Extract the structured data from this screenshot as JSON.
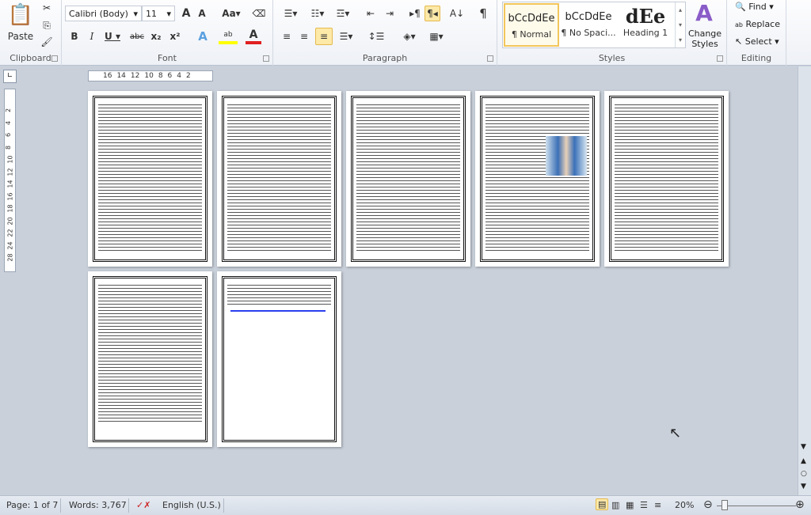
{
  "ribbon": {
    "clipboard": {
      "label": "Clipboard",
      "paste": "Paste"
    },
    "font": {
      "label": "Font",
      "name": "Calibri (Body)",
      "size": "11"
    },
    "paragraph": {
      "label": "Paragraph"
    },
    "styles": {
      "label": "Styles",
      "items": [
        {
          "preview": "bCcDdEe",
          "name": "¶ Normal"
        },
        {
          "preview": "bCcDdEe",
          "name": "¶ No Spaci..."
        },
        {
          "preview": "dEe",
          "name": "Heading 1"
        }
      ],
      "change": "Change Styles"
    },
    "editing": {
      "label": "Editing",
      "find": "Find",
      "replace": "Replace",
      "select": "Select"
    }
  },
  "ruler": {
    "ticks": [
      "16",
      "14",
      "12",
      "10",
      "8",
      "6",
      "4",
      "2"
    ],
    "vticks": [
      "2",
      "4",
      "6",
      "8",
      "10",
      "12",
      "14",
      "16",
      "18",
      "20",
      "22",
      "24",
      "28"
    ]
  },
  "document": {
    "page_count": 7
  },
  "status": {
    "page": "Page: 1 of 7",
    "words": "Words: 3,767",
    "language": "English (U.S.)",
    "zoom": "20%",
    "zoom_percent": 20
  },
  "colors": {
    "accent": "#fde9a8",
    "highlight": "#ffff00",
    "font_color": "#e02020"
  }
}
